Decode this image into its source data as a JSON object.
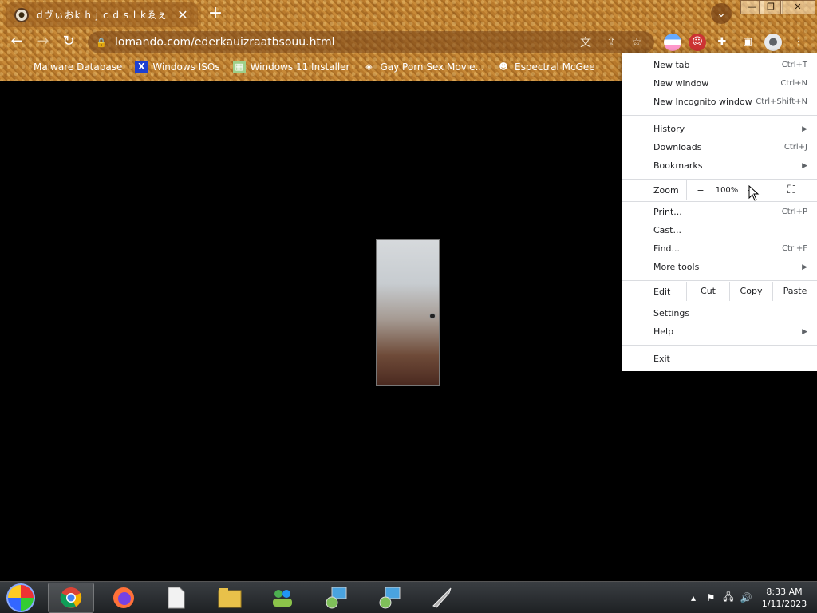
{
  "tab": {
    "title": "dヴぃおk h j c d s l kゑぇ",
    "close": "✕"
  },
  "newtab": "+",
  "window_controls": {
    "minimize": "—",
    "maximize": "❐",
    "close": "✕"
  },
  "omnibox": {
    "url": "lomando.com/ederkauizraatbsouu.html"
  },
  "bookmarks": [
    {
      "label": "Malware Database",
      "icon": "bookmark-icon"
    },
    {
      "label": "Windows ISOs",
      "icon": "x-icon"
    },
    {
      "label": "Windows 11 Installer",
      "icon": "image-icon"
    },
    {
      "label": "Gay Porn Sex Movie...",
      "icon": "globe-icon"
    },
    {
      "label": "Espectral McGee",
      "icon": "face-icon"
    }
  ],
  "menu": {
    "new_tab": "New tab",
    "new_tab_sc": "Ctrl+T",
    "new_window": "New window",
    "new_window_sc": "Ctrl+N",
    "incognito": "New Incognito window",
    "incognito_sc": "Ctrl+Shift+N",
    "history": "History",
    "downloads": "Downloads",
    "downloads_sc": "Ctrl+J",
    "bookmarks": "Bookmarks",
    "zoom": "Zoom",
    "zoom_minus": "−",
    "zoom_value": "100%",
    "zoom_plus": "+",
    "fullscreen": "⛶",
    "print": "Print...",
    "print_sc": "Ctrl+P",
    "cast": "Cast...",
    "find": "Find...",
    "find_sc": "Ctrl+F",
    "more_tools": "More tools",
    "edit": "Edit",
    "cut": "Cut",
    "copy": "Copy",
    "paste": "Paste",
    "settings": "Settings",
    "help": "Help",
    "exit": "Exit"
  },
  "taskbar": {
    "clock_time": "8:33 AM",
    "clock_date": "1/11/2023"
  }
}
